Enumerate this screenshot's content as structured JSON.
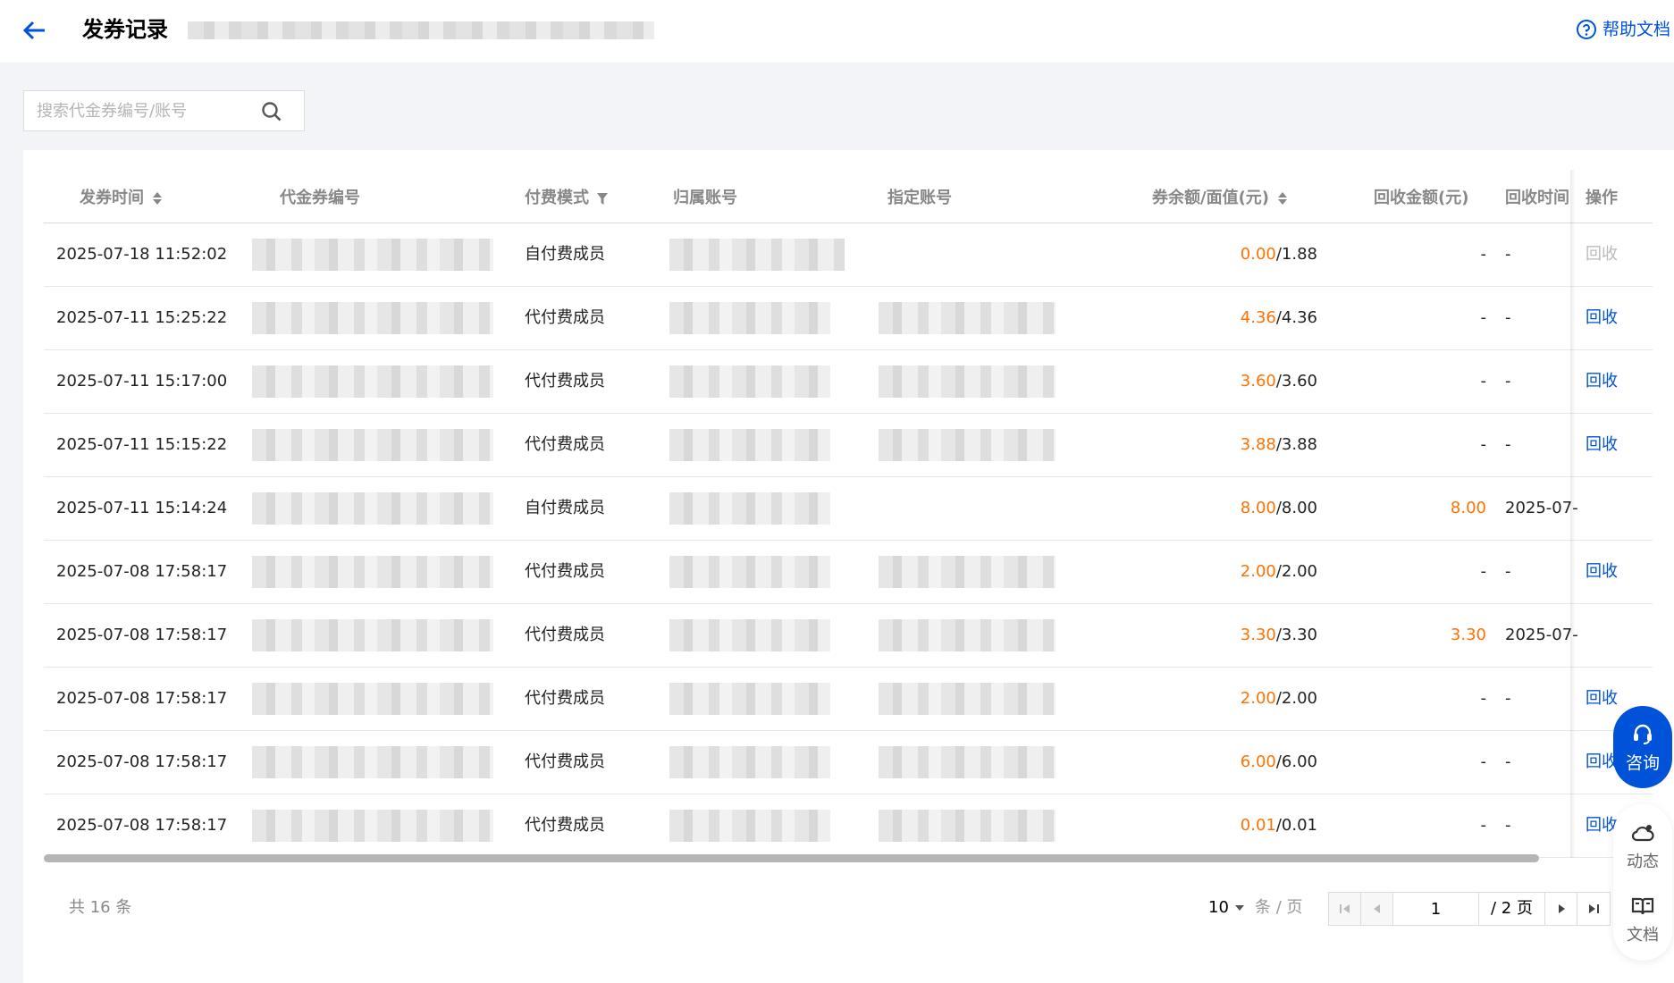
{
  "header": {
    "title": "发券记录",
    "help_label": "帮助文档"
  },
  "search": {
    "placeholder": "搜索代金券编号/账号"
  },
  "table": {
    "columns": {
      "issue_time": "发券时间",
      "voucher_id": "代金券编号",
      "pay_mode": "付费模式",
      "owner_account": "归属账号",
      "assigned_account": "指定账号",
      "balance_face": "券余额/面值(元)",
      "recovered_amount": "回收金额(元)",
      "recover_time": "回收时间",
      "action": "操作"
    },
    "rows": [
      {
        "time": "2025-07-18 11:52:02",
        "mode": "自付费成员",
        "remain": "0.00",
        "face": "/1.88",
        "recovered": "-",
        "recover_time": "-",
        "action": "回收",
        "action_enabled": false,
        "assigned": false
      },
      {
        "time": "2025-07-11 15:25:22",
        "mode": "代付费成员",
        "remain": "4.36",
        "face": "/4.36",
        "recovered": "-",
        "recover_time": "-",
        "action": "回收",
        "action_enabled": true,
        "assigned": true
      },
      {
        "time": "2025-07-11 15:17:00",
        "mode": "代付费成员",
        "remain": "3.60",
        "face": "/3.60",
        "recovered": "-",
        "recover_time": "-",
        "action": "回收",
        "action_enabled": true,
        "assigned": true
      },
      {
        "time": "2025-07-11 15:15:22",
        "mode": "代付费成员",
        "remain": "3.88",
        "face": "/3.88",
        "recovered": "-",
        "recover_time": "-",
        "action": "回收",
        "action_enabled": true,
        "assigned": true
      },
      {
        "time": "2025-07-11 15:14:24",
        "mode": "自付费成员",
        "remain": "8.00",
        "face": "/8.00",
        "recovered": "8.00",
        "recover_time": "2025-07-",
        "action": "",
        "action_enabled": false,
        "assigned": false
      },
      {
        "time": "2025-07-08 17:58:17",
        "mode": "代付费成员",
        "remain": "2.00",
        "face": "/2.00",
        "recovered": "-",
        "recover_time": "-",
        "action": "回收",
        "action_enabled": true,
        "assigned": true
      },
      {
        "time": "2025-07-08 17:58:17",
        "mode": "代付费成员",
        "remain": "3.30",
        "face": "/3.30",
        "recovered": "3.30",
        "recover_time": "2025-07-",
        "action": "",
        "action_enabled": false,
        "assigned": true
      },
      {
        "time": "2025-07-08 17:58:17",
        "mode": "代付费成员",
        "remain": "2.00",
        "face": "/2.00",
        "recovered": "-",
        "recover_time": "-",
        "action": "回收",
        "action_enabled": true,
        "assigned": true
      },
      {
        "time": "2025-07-08 17:58:17",
        "mode": "代付费成员",
        "remain": "6.00",
        "face": "/6.00",
        "recovered": "-",
        "recover_time": "-",
        "action": "回收",
        "action_enabled": true,
        "assigned": true
      },
      {
        "time": "2025-07-08 17:58:17",
        "mode": "代付费成员",
        "remain": "0.01",
        "face": "/0.01",
        "recovered": "-",
        "recover_time": "-",
        "action": "回收",
        "action_enabled": true,
        "assigned": true
      }
    ]
  },
  "pagination": {
    "total_text": "共  16  条",
    "page_size": "10",
    "page_size_unit": "条 / 页",
    "current_page": "1",
    "total_pages": "/ 2 页"
  },
  "float": {
    "consult_label": "咨询",
    "dynamic_label": "动态",
    "docs_label": "文档"
  },
  "colors": {
    "primary": "#0052d9",
    "amount": "#ff7200",
    "background": "#f3f4f7"
  }
}
